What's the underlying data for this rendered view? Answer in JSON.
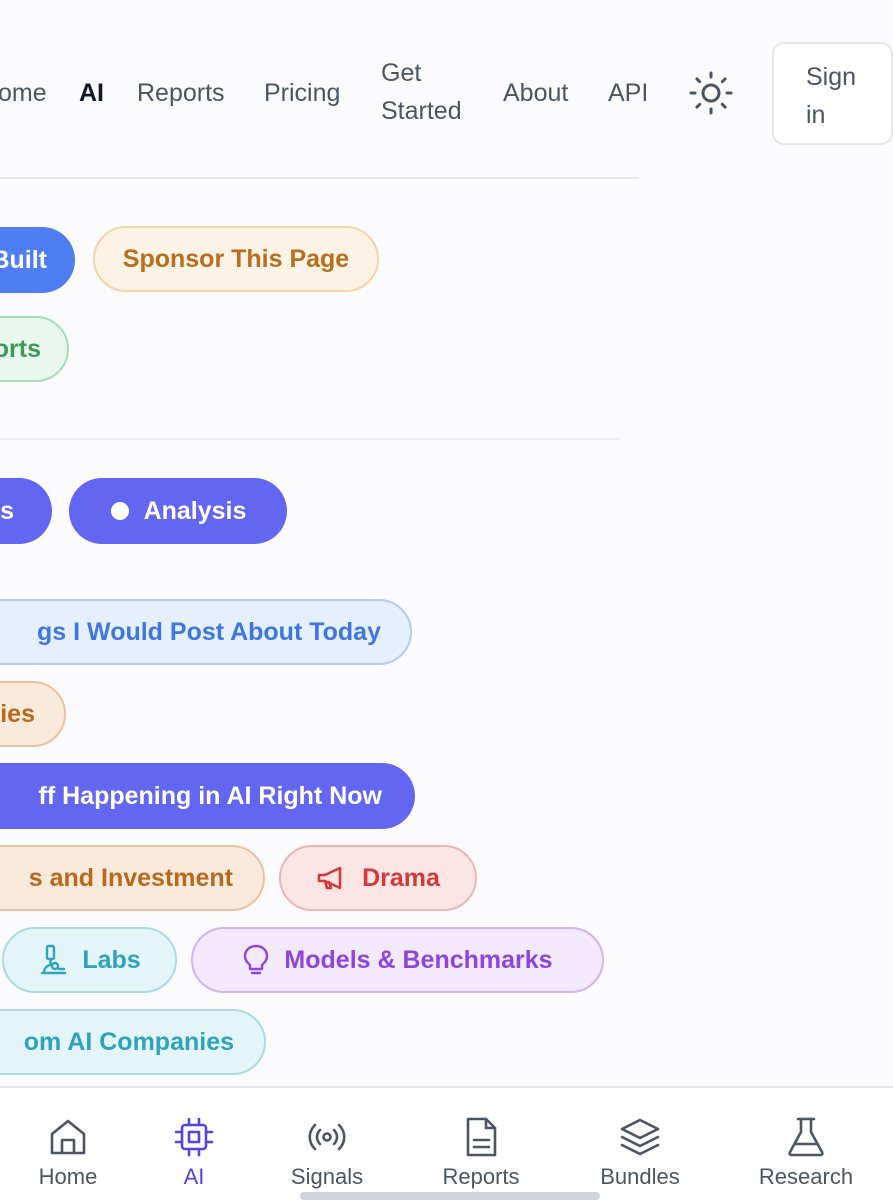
{
  "nav": {
    "items": [
      {
        "label": "ome",
        "active": false
      },
      {
        "label": "AI",
        "active": true
      },
      {
        "label": "Reports",
        "active": false
      },
      {
        "label": "Pricing",
        "active": false
      },
      {
        "label_line1": "Get",
        "label_line2": "Started",
        "active": false
      },
      {
        "label": "About",
        "active": false
      },
      {
        "label": "API",
        "active": false
      }
    ],
    "theme_icon": "sun-icon",
    "signin_line1": "Sign",
    "signin_line2": "in"
  },
  "top_pills": [
    {
      "label": "Built",
      "style": "blue-solid"
    },
    {
      "label": "Sponsor This Page",
      "style": "sponsor"
    },
    {
      "label": "orts",
      "style": "green"
    }
  ],
  "filter_pills": [
    {
      "label": "es",
      "style": "indigo"
    },
    {
      "label": "Analysis",
      "style": "indigo",
      "icon": "dot-icon"
    }
  ],
  "topic_pills": [
    {
      "label": "gs I Would Post About Today",
      "style": "lightblue"
    },
    {
      "label": "ies",
      "style": "orange"
    },
    {
      "label": "ff Happening in AI Right Now",
      "style": "indigo"
    },
    {
      "label": "s and Investment",
      "style": "orange"
    },
    {
      "label": "Drama",
      "style": "red",
      "icon": "megaphone-icon"
    },
    {
      "label": "Labs",
      "style": "cyan",
      "icon": "microscope-icon"
    },
    {
      "label": "Models & Benchmarks",
      "style": "purple",
      "icon": "lightbulb-icon"
    },
    {
      "label": "om AI Companies",
      "style": "cyan"
    }
  ],
  "bottom_tabs": [
    {
      "label": "Home",
      "icon": "home-icon",
      "active": false
    },
    {
      "label": "AI",
      "icon": "cpu-icon",
      "active": true
    },
    {
      "label": "Signals",
      "icon": "broadcast-icon",
      "active": false
    },
    {
      "label": "Reports",
      "icon": "document-icon",
      "active": false
    },
    {
      "label": "Bundles",
      "icon": "layers-icon",
      "active": false
    },
    {
      "label": "Research",
      "icon": "flask-icon",
      "active": false
    }
  ],
  "colors": {
    "accent_indigo": "#6366f1",
    "accent_blue": "#4f7ef2",
    "active_tab": "#4f46e5"
  }
}
